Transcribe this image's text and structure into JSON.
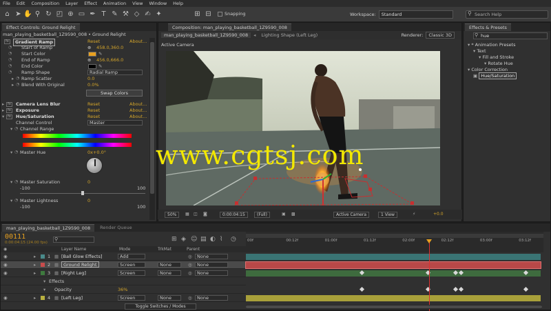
{
  "menu": [
    "File",
    "Edit",
    "Composition",
    "Layer",
    "Effect",
    "Animation",
    "View",
    "Window",
    "Help"
  ],
  "toolbar": {
    "snapping_label": "Snapping",
    "workspace_label": "Workspace:",
    "workspace_value": "Standard",
    "search_placeholder": "Search Help"
  },
  "effect_controls": {
    "tabs": [
      "Effect Controls: Ground Relight"
    ],
    "layer_path": "man_playing_basketball_1Z9590_008 • Ground Relight",
    "gradient_ramp": {
      "name": "Gradient Ramp",
      "reset": "Reset",
      "about": "About...",
      "start_of_ramp_label": "Start of Ramp",
      "start_of_ramp_value": "458.0,360.0",
      "start_color_label": "Start Color",
      "end_of_ramp_label": "End of Ramp",
      "end_of_ramp_value": "456.0,666.0",
      "end_color_label": "End Color",
      "ramp_shape_label": "Ramp Shape",
      "ramp_shape_value": "Radial Ramp",
      "ramp_scatter_label": "Ramp Scatter",
      "ramp_scatter_value": "0.0",
      "blend_label": "Blend With Original",
      "blend_value": "0.0%",
      "swap_button": "Swap Colors"
    },
    "lens_blur": {
      "name": "Camera Lens Blur",
      "reset": "Reset",
      "about": "About..."
    },
    "exposure": {
      "name": "Exposure",
      "reset": "Reset",
      "about": "About..."
    },
    "hue_sat": {
      "name": "Hue/Saturation",
      "reset": "Reset",
      "about": "About...",
      "channel_control_label": "Channel Control",
      "channel_control_value": "Master",
      "channel_range_label": "Channel Range",
      "master_hue_label": "Master Hue",
      "master_hue_value": "0x+0.0°",
      "master_saturation_label": "Master Saturation",
      "master_saturation_value": "0",
      "sat_min": "-100",
      "sat_max": "100",
      "master_lightness_label": "Master Lightness",
      "master_lightness_value": "0",
      "light_min": "-100",
      "light_max": "100"
    }
  },
  "composition": {
    "tab_title": "Composition: man_playing_basketball_1Z9590_008",
    "subtabs": [
      "man_playing_basketball_1Z9590_008",
      "Lighting Shape (Left Leg)"
    ],
    "renderer_label": "Renderer:",
    "renderer_value": "Classic 3D",
    "view_label": "Active Camera",
    "bottom": {
      "zoom": "50%",
      "resolution": "(Full)",
      "timecode": "0:00:04:15",
      "camera": "Active Camera",
      "views": "1 View",
      "plus": "+0.0"
    }
  },
  "right_panel": {
    "tab": "Effects & Presets",
    "search_value": "hue",
    "tree": [
      {
        "label": "* Animation Presets",
        "indent": 0
      },
      {
        "label": "Text",
        "indent": 1
      },
      {
        "label": "Fill and Stroke",
        "indent": 2
      },
      {
        "label": "Rotate Hue",
        "indent": 3
      },
      {
        "label": "Color Correction",
        "indent": 0
      },
      {
        "label": "Hue/Saturation",
        "indent": 1,
        "selected": true
      }
    ]
  },
  "timeline": {
    "tabs": [
      "man_playing_basketball_1Z9590_008",
      "Render Queue"
    ],
    "timecode": "00111",
    "subcode": "0:00:04:15 (24.00 fps)",
    "columns": {
      "name": "Layer Name",
      "mode": "Mode",
      "trkmat": "TrkMat",
      "parent": "Parent"
    },
    "ruler": [
      "00f",
      "00:12f",
      "01:00f",
      "01:12f",
      "02:00f",
      "02:12f",
      "03:00f",
      "03:12f"
    ],
    "toggle_label": "Toggle Switches / Modes",
    "layers": [
      {
        "num": "1",
        "name": "[Ball Glow Effects]",
        "mode": "Add",
        "trkmat": "",
        "parent": "None",
        "color": "#4a8a8a"
      },
      {
        "num": "2",
        "name": "Ground Relight",
        "mode": "Screen",
        "trkmat": "None",
        "parent": "None",
        "color": "#c84c4c",
        "selected": true
      },
      {
        "num": "3",
        "name": "[Right Leg]",
        "mode": "Screen",
        "trkmat": "None",
        "parent": "None",
        "color": "#3e7a3e"
      },
      {
        "num": "",
        "name": "Effects",
        "mode": "",
        "trkmat": "",
        "parent": "",
        "color": ""
      },
      {
        "num": "",
        "name": "Opacity",
        "mode": "36%",
        "trkmat": "",
        "parent": "",
        "color": ""
      },
      {
        "num": "4",
        "name": "[Left Leg]",
        "mode": "Screen",
        "trkmat": "None",
        "parent": "None",
        "color": "#b8b040"
      }
    ]
  },
  "watermark": "www.cgtsj.com"
}
